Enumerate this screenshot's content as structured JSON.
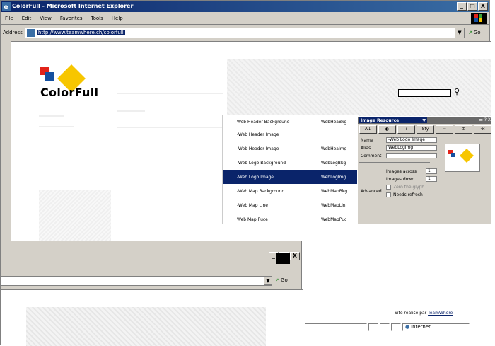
{
  "window": {
    "title": "ColorFull - Microsoft Internet Explorer",
    "controls": [
      "_",
      "□",
      "X"
    ]
  },
  "menu": [
    "File",
    "Edit",
    "View",
    "Favorites",
    "Tools",
    "Help"
  ],
  "address": {
    "label": "Address",
    "url": "http://www.teamwhere.ch/colorfull",
    "go_label": "Go"
  },
  "page": {
    "brand": "ColorFull",
    "footer_prefix": "Site réalisé par",
    "footer_link": "TeamWhere",
    "colors": {
      "red": "#e2231a",
      "blue": "#1450a0",
      "yellow": "#f7c600"
    }
  },
  "list": [
    {
      "name": "Web Header Background",
      "value": "WebHeaBkg"
    },
    {
      "name": "-Web Header Image",
      "value": ""
    },
    {
      "name": "-Web Header Image",
      "value": "WebHeaImg"
    },
    {
      "name": "-Web Logo Background",
      "value": "WebLogBkg"
    },
    {
      "name": "-Web Logo Image",
      "value": "WebLogImg",
      "selected": true
    },
    {
      "name": "-Web Map Background",
      "value": "WebMapBkg"
    },
    {
      "name": "-Web Map Line",
      "value": "WebMapLin"
    },
    {
      "name": "Web Map Puce",
      "value": "WebMapPuc"
    }
  ],
  "props": {
    "title": "Image Resource",
    "ctrl": "▬ ? X",
    "tools": [
      "A↓",
      "◐",
      "i",
      "Sty",
      "⊢",
      "⊞",
      "≪"
    ],
    "name_label": "Name",
    "name_value": "-Web Logo Image",
    "alias_label": "Alias",
    "alias_value": "WebLogImg",
    "comment_label": "Comment",
    "comment_value": "",
    "adv_label": "Advanced",
    "across_label": "Images across",
    "across_value": "1",
    "down_label": "Images down",
    "down_value": "1",
    "trans_label": "Zero the glyph",
    "refresh_label": "Needs refresh"
  },
  "status": {
    "zone": "Internet"
  }
}
